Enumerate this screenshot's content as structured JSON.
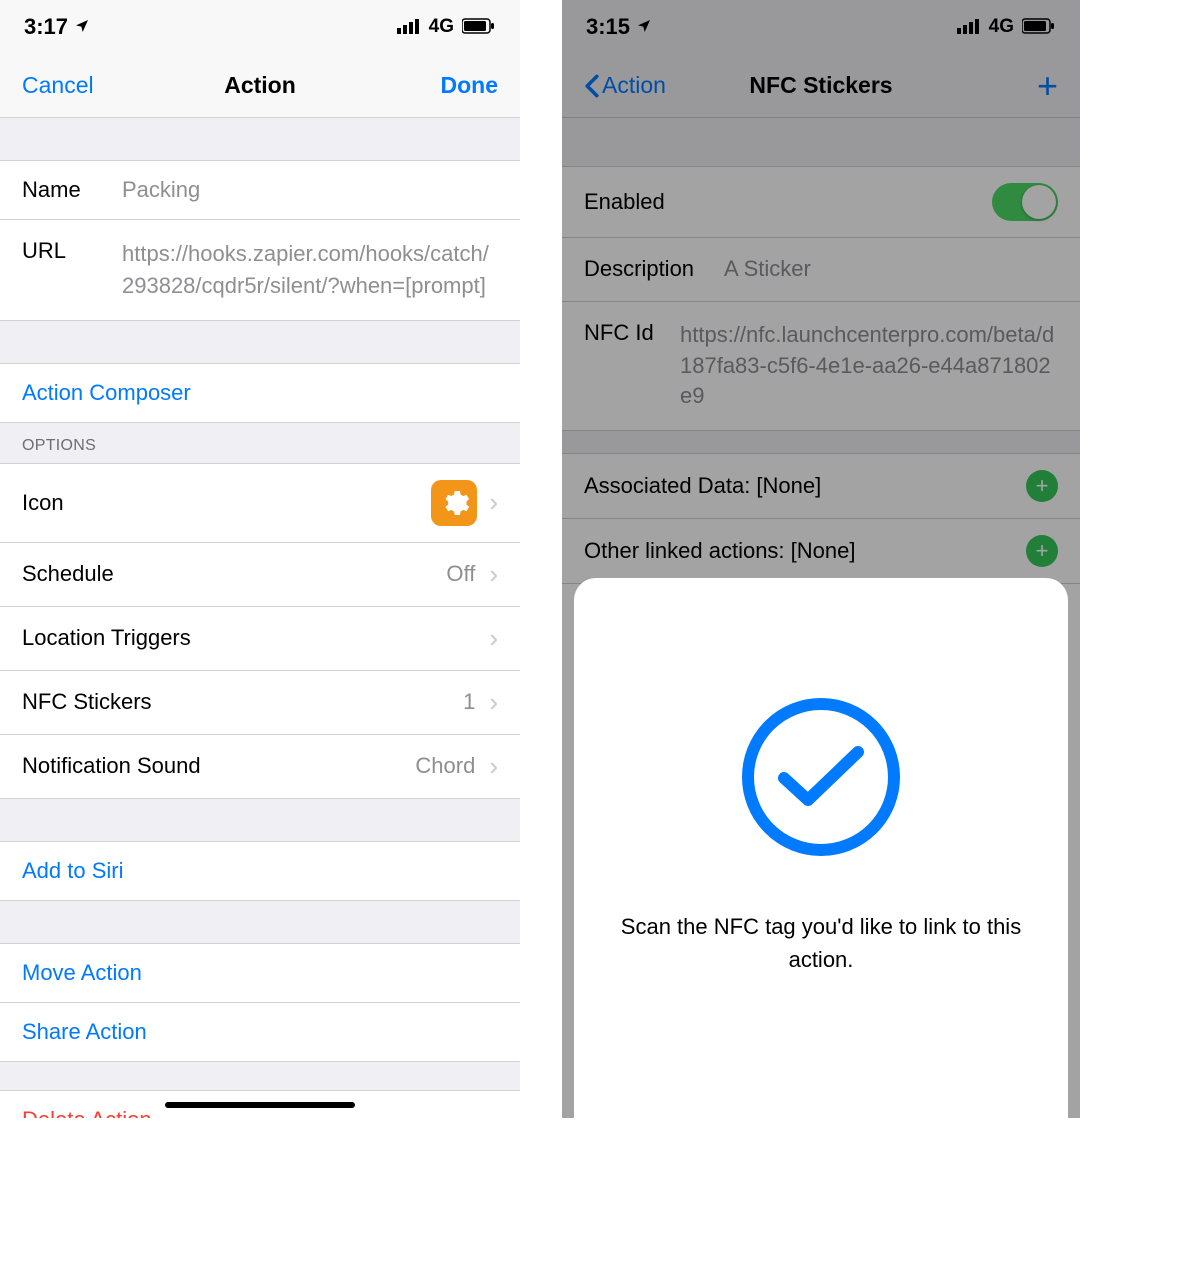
{
  "left": {
    "status": {
      "time": "3:17",
      "network": "4G"
    },
    "nav": {
      "cancel": "Cancel",
      "title": "Action",
      "done": "Done"
    },
    "fields": {
      "name_label": "Name",
      "name_value": "Packing",
      "url_label": "URL",
      "url_value": "https://hooks.zapier.com/hooks/catch/293828/cqdr5r/silent/?when=[prompt]"
    },
    "composer": "Action Composer",
    "options_header": "OPTIONS",
    "options": {
      "icon": "Icon",
      "schedule_label": "Schedule",
      "schedule_value": "Off",
      "location": "Location Triggers",
      "nfc_label": "NFC Stickers",
      "nfc_value": "1",
      "sound_label": "Notification Sound",
      "sound_value": "Chord"
    },
    "siri": "Add to Siri",
    "move": "Move Action",
    "share": "Share Action",
    "delete": "Delete Action"
  },
  "right": {
    "status": {
      "time": "3:15",
      "network": "4G"
    },
    "nav": {
      "back": "Action",
      "title": "NFC Stickers"
    },
    "enabled_label": "Enabled",
    "desc_label": "Description",
    "desc_value": "A Sticker",
    "nfcid_label": "NFC Id",
    "nfcid_value": "https://nfc.launchcenterpro.com/beta/d187fa83-c5f6-4e1e-aa26-e44a871802e9",
    "associated": "Associated Data: [None]",
    "other_linked": "Other linked actions: [None]",
    "sheet_text": "Scan the NFC tag you'd like to link to this action."
  }
}
